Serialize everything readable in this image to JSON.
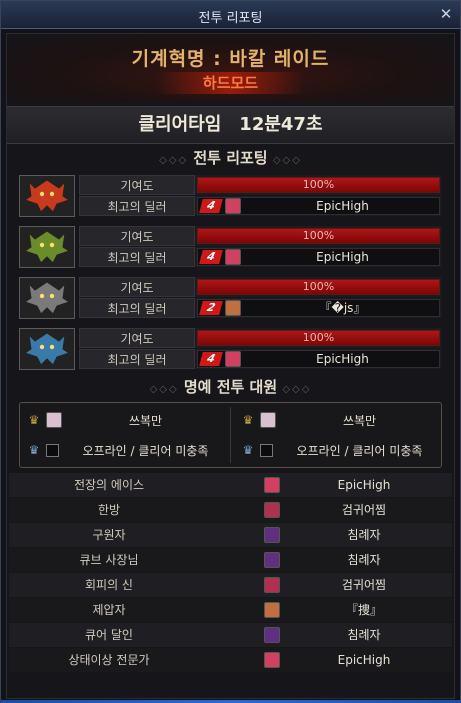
{
  "window": {
    "title": "전투 리포팅",
    "close_glyph": "✕"
  },
  "header": {
    "raid_name": "기계혁명 : 바칼 레이드",
    "mode": "하드모드"
  },
  "clear_time": {
    "label": "클리어타임",
    "value": "12분47초"
  },
  "reporting_title": "전투 리포팅",
  "reports": [
    {
      "contribution_label": "기여도",
      "contribution_pct": "100%",
      "contribution_value": 1.0,
      "dealer_label": "최고의 딜러",
      "rank": "4",
      "dealer_name": "EpicHigh",
      "icon": "red-dragon-icon",
      "icon_color": "#c83a1c",
      "avatar_color": "#d04060"
    },
    {
      "contribution_label": "기여도",
      "contribution_pct": "100%",
      "contribution_value": 1.0,
      "dealer_label": "최고의 딜러",
      "rank": "4",
      "dealer_name": "EpicHigh",
      "icon": "green-dragon-icon",
      "icon_color": "#6a8c2a",
      "avatar_color": "#d04060"
    },
    {
      "contribution_label": "기여도",
      "contribution_pct": "100%",
      "contribution_value": 1.0,
      "dealer_label": "최고의 딜러",
      "rank": "2",
      "dealer_name": "『�js』",
      "icon": "gray-dragon-icon",
      "icon_color": "#7a7a7a",
      "avatar_color": "#c07040"
    },
    {
      "contribution_label": "기여도",
      "contribution_pct": "100%",
      "contribution_value": 1.0,
      "dealer_label": "최고의 딜러",
      "rank": "4",
      "dealer_name": "EpicHigh",
      "icon": "blue-dragon-icon",
      "icon_color": "#3a7aa8",
      "avatar_color": "#d04060"
    }
  ],
  "honor_title": "명예 전투 대원",
  "honor": [
    {
      "name": "쓰복만",
      "type": "player"
    },
    {
      "name": "쓰복만",
      "type": "player"
    },
    {
      "name": "오프라인 / 클리어 미충족",
      "type": "offline"
    },
    {
      "name": "오프라인 / 클리어 미충족",
      "type": "offline"
    }
  ],
  "titles": [
    {
      "title": "전장의 에이스",
      "player": "EpicHigh",
      "avatar_color": "#d04060"
    },
    {
      "title": "한방",
      "player": "검귀어찜",
      "avatar_color": "#b03050"
    },
    {
      "title": "구원자",
      "player": "침례자",
      "avatar_color": "#603080"
    },
    {
      "title": "큐브 사장님",
      "player": "침례자",
      "avatar_color": "#603080"
    },
    {
      "title": "회피의 신",
      "player": "검귀어찜",
      "avatar_color": "#b03050"
    },
    {
      "title": "제압자",
      "player": "『捜』",
      "avatar_color": "#c07040"
    },
    {
      "title": "큐어 달인",
      "player": "침례자",
      "avatar_color": "#603080"
    },
    {
      "title": "상태이상 전문가",
      "player": "EpicHigh",
      "avatar_color": "#d04060"
    }
  ]
}
